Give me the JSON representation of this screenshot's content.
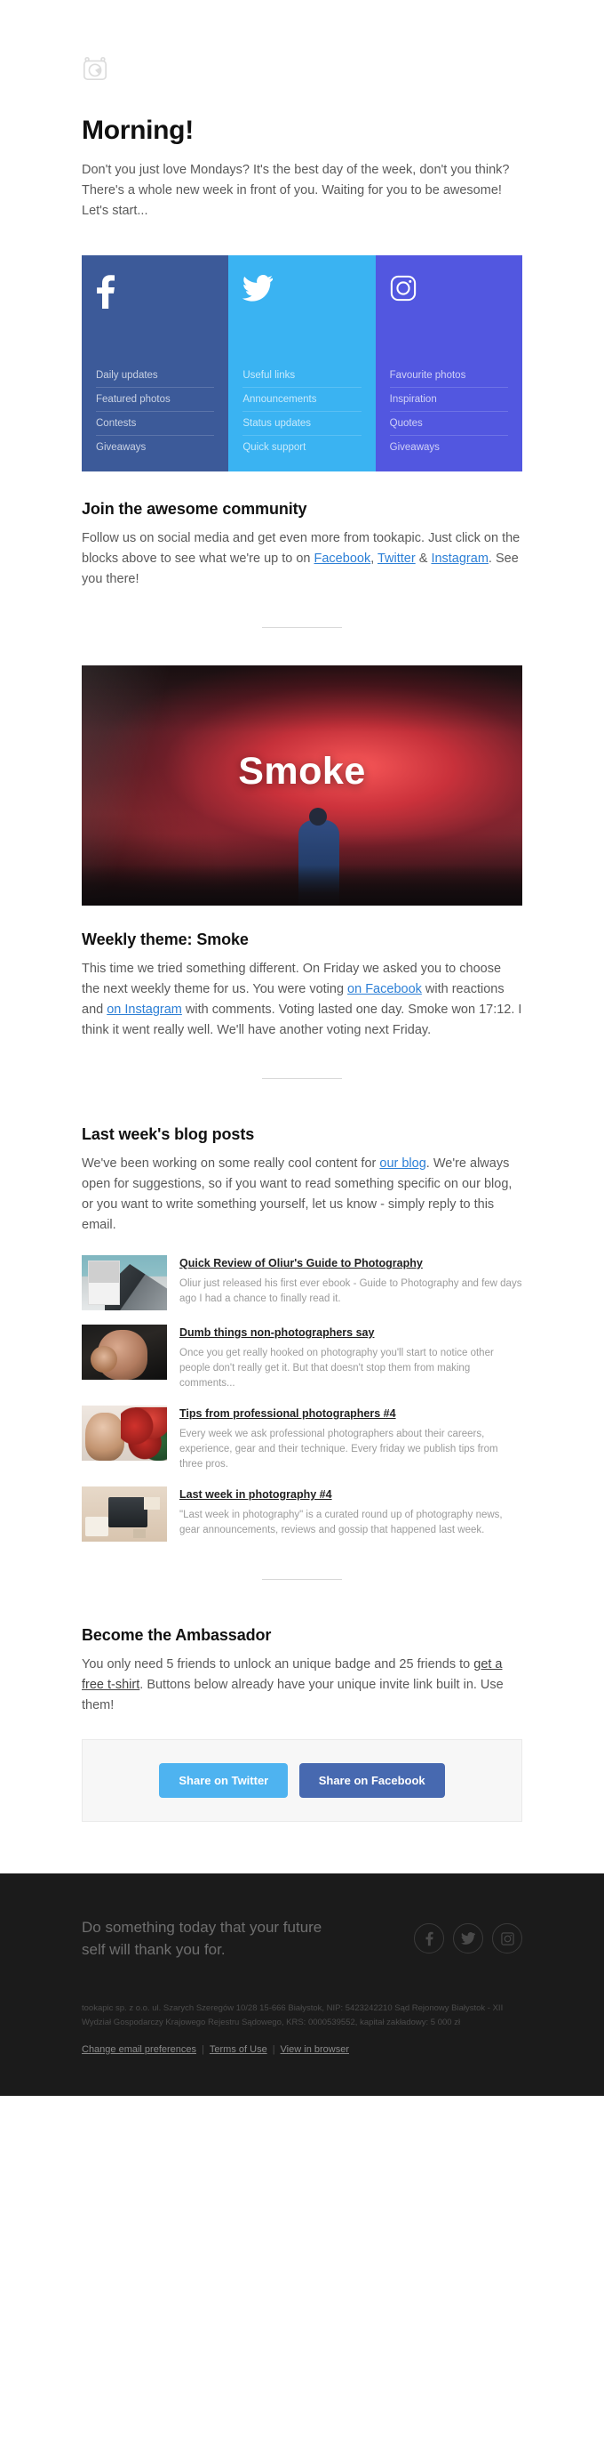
{
  "brand": {
    "logo_icon": "tookapic-camera-logo"
  },
  "header": {
    "greeting": "Morning!",
    "intro": "Don't you just love Mondays? It's the best day of the week, don't you think? There's a whole new week in front of you. Waiting for you to be awesome! Let's start..."
  },
  "social_blocks": [
    {
      "network": "Facebook",
      "icon": "facebook-icon",
      "color": "#3c5a99",
      "links": [
        "Daily updates",
        "Featured photos",
        "Contests",
        "Giveaways"
      ]
    },
    {
      "network": "Twitter",
      "icon": "twitter-icon",
      "color": "#3ab3f2",
      "links": [
        "Useful links",
        "Announcements",
        "Status updates",
        "Quick support"
      ]
    },
    {
      "network": "Instagram",
      "icon": "instagram-icon",
      "color": "#5257e0",
      "links": [
        "Favourite photos",
        "Inspiration",
        "Quotes",
        "Giveaways"
      ]
    }
  ],
  "community": {
    "title": "Join the awesome community",
    "text_1": "Follow us on social media and get even more from tookapic. Just click on the blocks above to see what we're up to on ",
    "link_facebook": "Facebook",
    "text_2": ", ",
    "link_twitter": "Twitter",
    "text_3": " & ",
    "link_instagram": "Instagram",
    "text_4": ". See you there!"
  },
  "weekly_theme": {
    "hero_title": "Smoke",
    "title": "Weekly theme: Smoke",
    "text_1": "This time we tried something different. On Friday we asked you to choose the next weekly theme for us. You were voting ",
    "link_facebook": "on Facebook",
    "text_2": " with reactions and ",
    "link_instagram": "on Instagram",
    "text_3": " with comments. Voting lasted one day. Smoke won 17:12. I think it went really well. We'll have another voting next Friday."
  },
  "blog": {
    "title": "Last week's blog posts",
    "intro_1": "We've been working on some really cool content for ",
    "intro_link": "our blog",
    "intro_2": ". We're always open for suggestions, so if you want to read something specific on our blog, or you want to write something yourself, let us know - simply reply to this email.",
    "posts": [
      {
        "title": "Quick Review of Oliur's Guide to Photography",
        "description": "Oliur just released his first ever ebook - Guide to Photography and few days ago I had a chance to finally read it.",
        "thumb": "house-ebook-thumbnail"
      },
      {
        "title": "Dumb things non-photographers say",
        "description": "Once you get really hooked on photography you'll start to notice other people don't really get it. But that doesn't stop them from making comments...",
        "thumb": "facepalm-thumbnail"
      },
      {
        "title": "Tips from professional photographers #4",
        "description": "Every week we ask professional photographers about their careers, experience, gear and their technique. Every friday we publish tips from three pros.",
        "thumb": "photographer-flowers-thumbnail"
      },
      {
        "title": "Last week in photography #4",
        "description": "\"Last week in photography\" is a curated round up of photography news, gear announcements, reviews and gossip that happened last week.",
        "thumb": "desk-laptop-thumbnail"
      }
    ]
  },
  "ambassador": {
    "title": "Become the Ambassador",
    "text_1": "You only need 5 friends to unlock an unique badge and 25 friends to ",
    "link": "get a free t-shirt",
    "text_2": ". Buttons below already have your unique invite link built in. Use them!",
    "button_twitter": "Share on Twitter",
    "button_facebook": "Share on Facebook",
    "button_twitter_color": "#4eb3f0",
    "button_facebook_color": "#4769b0"
  },
  "footer": {
    "slogan": "Do something today that your future self will thank you for.",
    "socials": [
      "facebook-icon",
      "twitter-icon",
      "instagram-icon"
    ],
    "legal": "tookapic sp. z o.o. ul. Szarych Szeregów 10/28 15-666 Białystok, NIP: 5423242210 Sąd Rejonowy Białystok - XII Wydział Gospodarczy Krajowego Rejestru Sądowego, KRS: 0000539552, kapitał zakładowy: 5 000 zł",
    "links": [
      "Change email preferences",
      "Terms of Use",
      "View in browser"
    ]
  }
}
